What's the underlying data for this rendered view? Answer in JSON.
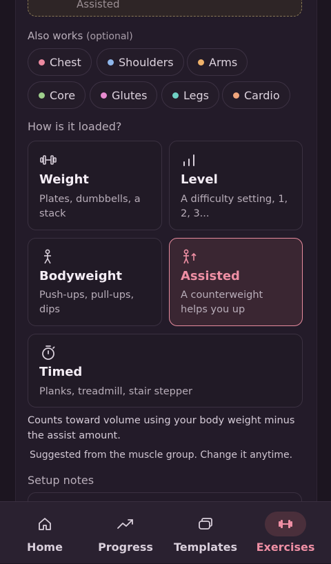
{
  "top_card": {
    "label": "Assisted"
  },
  "also_works": {
    "label": "Also works",
    "optional": "(optional)",
    "chips": [
      {
        "label": "Chest",
        "color": "#ec8aa0"
      },
      {
        "label": "Shoulders",
        "color": "#8fb7ec"
      },
      {
        "label": "Arms",
        "color": "#f0b26a"
      },
      {
        "label": "Core",
        "color": "#9fcf8c"
      },
      {
        "label": "Glutes",
        "color": "#e88bd0"
      },
      {
        "label": "Legs",
        "color": "#6fd0c4"
      },
      {
        "label": "Cardio",
        "color": "#f0a57c"
      }
    ]
  },
  "loading": {
    "label": "How is it loaded?",
    "options": [
      {
        "title": "Weight",
        "desc": "Plates, dumbbells, a stack",
        "icon": "dumbbell-icon",
        "selected": false
      },
      {
        "title": "Level",
        "desc": "A difficulty setting, 1, 2, 3...",
        "icon": "bars-icon",
        "selected": false
      },
      {
        "title": "Bodyweight",
        "desc": "Push-ups, pull-ups, dips",
        "icon": "person-icon",
        "selected": false
      },
      {
        "title": "Assisted",
        "desc": "A counterweight helps you up",
        "icon": "person-up-icon",
        "selected": true
      },
      {
        "title": "Timed",
        "desc": "Planks, treadmill, stair stepper",
        "icon": "stopwatch-icon",
        "selected": false
      }
    ]
  },
  "explanation": "Counts toward volume using your body weight minus the assist amount.",
  "suggestion": "Suggested from the muscle group. Change it anytime.",
  "setup_notes": {
    "label": "Setup notes"
  },
  "nav": {
    "items": [
      {
        "label": "Home",
        "icon": "home-icon",
        "active": false
      },
      {
        "label": "Progress",
        "icon": "trend-icon",
        "active": false
      },
      {
        "label": "Templates",
        "icon": "templates-icon",
        "active": false
      },
      {
        "label": "Exercises",
        "icon": "dumbbell-icon",
        "active": true
      }
    ]
  },
  "colors": {
    "accent": "#ef8fa4",
    "background": "#231b29"
  }
}
